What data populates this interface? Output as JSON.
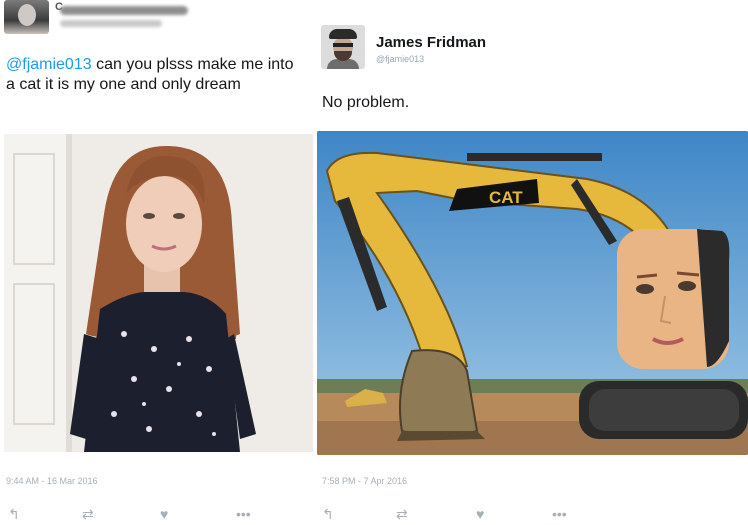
{
  "left_tweet": {
    "redacted_name_initial": "C",
    "text_mention": "@fjamie013",
    "text_body": " can you plsss make me into a cat it is my one and only dream",
    "timestamp": "9:44 AM - 16 Mar 2016",
    "photo_alt": "",
    "actions": {
      "reply_icon": "reply-icon",
      "retweet_icon": "retweet-icon",
      "like_icon": "heart-icon",
      "more_icon": "more-icon"
    }
  },
  "right_tweet": {
    "name": "James Fridman",
    "handle": "@fjamie013",
    "text": "No problem.",
    "timestamp": "7:58 PM - 7 Apr 2016",
    "machine_logo": "CAT",
    "actions": {
      "reply_icon": "reply-icon",
      "retweet_icon": "retweet-icon",
      "like_icon": "heart-icon",
      "more_icon": "more-icon"
    }
  },
  "glyphs": {
    "reply": "↰",
    "retweet": "⇄",
    "like": "♥",
    "more": "•••"
  },
  "colors": {
    "link": "#1d9bf0",
    "muted": "#a6b0b8",
    "sky": "#4a8ecb",
    "machine_yellow": "#e8b93a"
  }
}
